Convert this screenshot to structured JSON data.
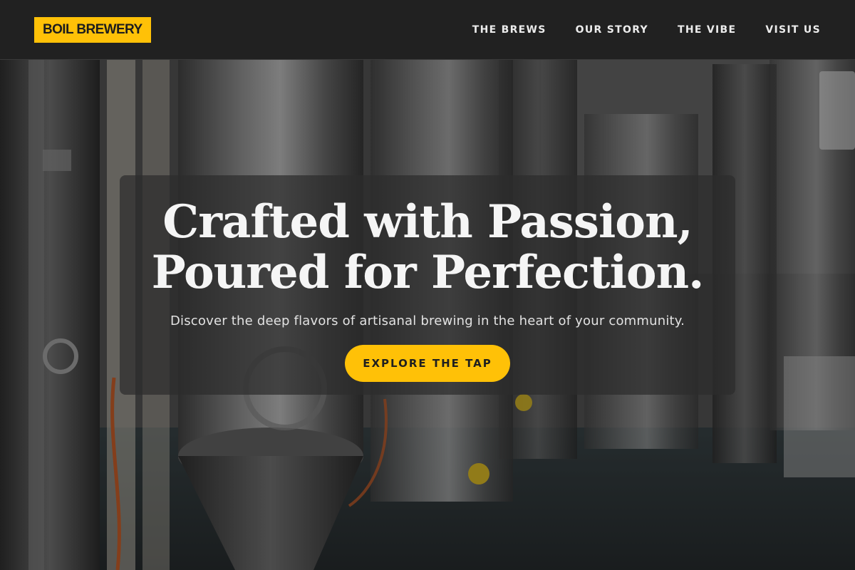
{
  "brand": {
    "name": "BOIL BREWERY",
    "accent": "#ffc107"
  },
  "nav": {
    "items": [
      {
        "label": "THE BREWS"
      },
      {
        "label": "OUR STORY"
      },
      {
        "label": "THE VIBE"
      },
      {
        "label": "VISIT US"
      }
    ]
  },
  "hero": {
    "title_line1": "Crafted with Passion,",
    "title_line2": "Poured for Perfection.",
    "subtitle": "Discover the deep flavors of artisanal brewing in the heart of your community.",
    "cta_label": "EXPLORE THE TAP"
  }
}
